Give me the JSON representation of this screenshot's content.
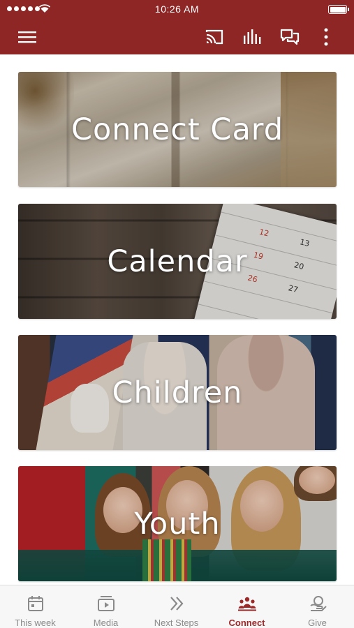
{
  "status_bar": {
    "time": "10:26 AM"
  },
  "app_bar": {
    "background_color": "#8e2626",
    "actions": [
      "menu-icon",
      "cast-icon",
      "equalizer-icon",
      "chat-icon",
      "more-vertical-icon"
    ]
  },
  "cards": [
    {
      "title": "Connect Card"
    },
    {
      "title": "Calendar",
      "calendar_numbers": [
        "12",
        "13",
        "19",
        "20",
        "26",
        "27"
      ]
    },
    {
      "title": "Children"
    },
    {
      "title": "Youth"
    }
  ],
  "tab_bar": {
    "active_color": "#9a2a2a",
    "inactive_color": "#8a8a8a",
    "tabs": [
      {
        "label": "This week",
        "icon": "calendar-icon"
      },
      {
        "label": "Media",
        "icon": "media-play-icon"
      },
      {
        "label": "Next Steps",
        "icon": "double-chevron-icon"
      },
      {
        "label": "Connect",
        "icon": "people-icon",
        "active": true
      },
      {
        "label": "Give",
        "icon": "give-icon"
      }
    ]
  }
}
